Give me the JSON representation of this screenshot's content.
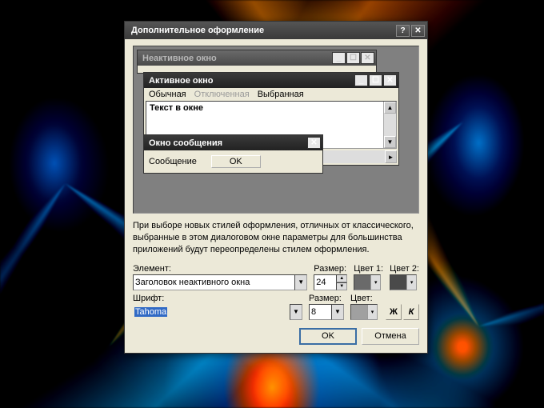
{
  "dialog": {
    "title": "Дополнительное оформление",
    "help_label": "?",
    "close_label": "✕"
  },
  "preview": {
    "inactive_title": "Неактивное окно",
    "active_title": "Активное окно",
    "menu": {
      "normal": "Обычная",
      "disabled": "Отключенная",
      "selected": "Выбранная"
    },
    "textarea_text": "Текст в окне",
    "msgbox": {
      "title": "Окно сообщения",
      "text": "Сообщение",
      "ok": "OK"
    }
  },
  "description": "При выборе новых стилей оформления, отличных от классического, выбранные в этом диалоговом окне параметры для большинства приложений будут переопределены стилем оформления.",
  "labels": {
    "element": "Элемент:",
    "size": "Размер:",
    "color1": "Цвет 1:",
    "color2": "Цвет 2:",
    "font": "Шрифт:",
    "color": "Цвет:",
    "bold": "Ж",
    "italic": "К"
  },
  "values": {
    "element": "Заголовок неактивного окна",
    "element_size": "24",
    "font_name": "Tahoma",
    "font_size": "8",
    "color1": "#6a6a6a",
    "color2": "#4a4a4a",
    "font_color": "#a0a0a0"
  },
  "buttons": {
    "ok": "OK",
    "cancel": "Отмена"
  }
}
